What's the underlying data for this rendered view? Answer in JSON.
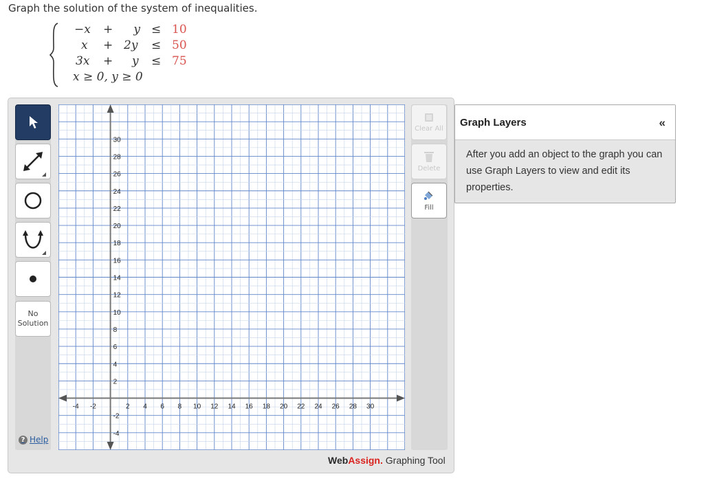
{
  "prompt": "Graph the solution of the system of inequalities.",
  "system": {
    "rows": [
      {
        "a": "−x",
        "op1": "+",
        "b": "y",
        "rel": "≤",
        "rhs": "10"
      },
      {
        "a": "x",
        "op1": "+",
        "b": "2y",
        "rel": "≤",
        "rhs": "50"
      },
      {
        "a": "3x",
        "op1": "+",
        "b": "y",
        "rel": "≤",
        "rhs": "75"
      }
    ],
    "nonneg": "x ≥ 0,  y ≥ 0"
  },
  "tools": {
    "pointer": "pointer-icon",
    "line": "line-icon",
    "circle": "circle-icon",
    "parabola": "parabola-icon",
    "point": "point-icon",
    "no_solution_line1": "No",
    "no_solution_line2": "Solution"
  },
  "help_label": "Help",
  "right_tools": {
    "clear_all": "Clear All",
    "delete": "Delete",
    "fill": "Fill"
  },
  "graph": {
    "x_ticks": [
      "-4",
      "-2",
      "2",
      "4",
      "6",
      "8",
      "10",
      "12",
      "14",
      "16",
      "18",
      "20",
      "22",
      "24",
      "26",
      "28",
      "30"
    ],
    "y_ticks": [
      "30",
      "28",
      "26",
      "24",
      "22",
      "20",
      "18",
      "16",
      "14",
      "12",
      "10",
      "8",
      "6",
      "4",
      "2",
      "-2",
      "-4"
    ],
    "x_range": [
      -6,
      34
    ],
    "y_range": [
      -6,
      34
    ]
  },
  "brand": {
    "web": "Web",
    "assign": "Assign.",
    "rest": " Graphing Tool"
  },
  "layers": {
    "title": "Graph Layers",
    "collapse": "«",
    "body": "After you add an object to the graph you can use Graph Layers to view and edit its properties."
  },
  "colors": {
    "accent": "#233c63",
    "grid_minor": "#c3d3ea",
    "grid_major": "#5f86c9",
    "axis": "#777777",
    "brand_red": "#d9231f"
  }
}
